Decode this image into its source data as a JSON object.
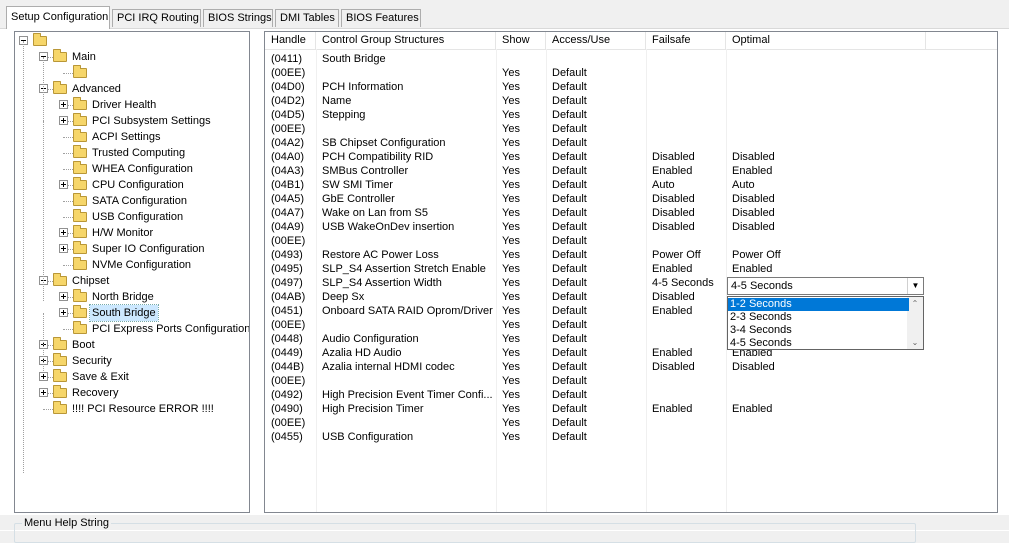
{
  "tabs": [
    {
      "label": "Setup Configuration",
      "active": true
    },
    {
      "label": "PCI IRQ Routing",
      "active": false
    },
    {
      "label": "BIOS Strings",
      "active": false
    },
    {
      "label": "DMI Tables",
      "active": false
    },
    {
      "label": "BIOS Features",
      "active": false
    }
  ],
  "tree": [
    {
      "label": "",
      "level": 0,
      "expander": "minus"
    },
    {
      "label": "Main",
      "level": 1,
      "expander": "minus"
    },
    {
      "label": "",
      "level": 2,
      "expander": "none"
    },
    {
      "label": "Advanced",
      "level": 1,
      "expander": "minus"
    },
    {
      "label": "Driver Health",
      "level": 2,
      "expander": "plus"
    },
    {
      "label": "PCI Subsystem Settings",
      "level": 2,
      "expander": "plus"
    },
    {
      "label": "ACPI Settings",
      "level": 2,
      "expander": "none"
    },
    {
      "label": "Trusted Computing",
      "level": 2,
      "expander": "none"
    },
    {
      "label": "WHEA Configuration",
      "level": 2,
      "expander": "none"
    },
    {
      "label": "CPU Configuration",
      "level": 2,
      "expander": "plus"
    },
    {
      "label": "SATA Configuration",
      "level": 2,
      "expander": "none"
    },
    {
      "label": "USB Configuration",
      "level": 2,
      "expander": "none"
    },
    {
      "label": "H/W Monitor",
      "level": 2,
      "expander": "plus"
    },
    {
      "label": "Super IO Configuration",
      "level": 2,
      "expander": "plus"
    },
    {
      "label": "NVMe Configuration",
      "level": 2,
      "expander": "none"
    },
    {
      "label": "Chipset",
      "level": 1,
      "expander": "minus"
    },
    {
      "label": "North Bridge",
      "level": 2,
      "expander": "plus"
    },
    {
      "label": "South Bridge",
      "level": 2,
      "expander": "plus",
      "selected": true
    },
    {
      "label": "PCI Express Ports Configuration",
      "level": 2,
      "expander": "none"
    },
    {
      "label": "Boot",
      "level": 1,
      "expander": "plus"
    },
    {
      "label": "Security",
      "level": 1,
      "expander": "plus"
    },
    {
      "label": "Save & Exit",
      "level": 1,
      "expander": "plus"
    },
    {
      "label": "Recovery",
      "level": 1,
      "expander": "plus"
    },
    {
      "label": "!!!! PCI Resource ERROR !!!!",
      "level": 1,
      "expander": "none"
    }
  ],
  "grid": {
    "columns": [
      "Handle",
      "Control Group Structures",
      "Show",
      "Access/Use",
      "Failsafe",
      "Optimal"
    ],
    "rows": [
      [
        "(0411)",
        "South Bridge",
        "",
        "",
        "",
        ""
      ],
      [
        "(00EE)",
        "",
        "Yes",
        "Default",
        "",
        ""
      ],
      [
        "(04D0)",
        "PCH Information",
        "Yes",
        "Default",
        "",
        ""
      ],
      [
        "(04D2)",
        "Name",
        "Yes",
        "Default",
        "",
        ""
      ],
      [
        "(04D5)",
        "Stepping",
        "Yes",
        "Default",
        "",
        ""
      ],
      [
        "(00EE)",
        "",
        "Yes",
        "Default",
        "",
        ""
      ],
      [
        "(04A2)",
        "SB Chipset Configuration",
        "Yes",
        "Default",
        "",
        ""
      ],
      [
        "(04A0)",
        "PCH Compatibility RID",
        "Yes",
        "Default",
        "Disabled",
        "Disabled"
      ],
      [
        "(04A3)",
        "SMBus Controller",
        "Yes",
        "Default",
        "Enabled",
        "Enabled"
      ],
      [
        "(04B1)",
        "SW SMI Timer",
        "Yes",
        "Default",
        "Auto",
        "Auto"
      ],
      [
        "(04A5)",
        "GbE Controller",
        "Yes",
        "Default",
        "Disabled",
        "Disabled"
      ],
      [
        "(04A7)",
        "Wake on Lan from S5",
        "Yes",
        "Default",
        "Disabled",
        "Disabled"
      ],
      [
        "(04A9)",
        "USB WakeOnDev insertion",
        "Yes",
        "Default",
        "Disabled",
        "Disabled"
      ],
      [
        "(00EE)",
        "",
        "Yes",
        "Default",
        "",
        ""
      ],
      [
        "(0493)",
        "Restore AC Power Loss",
        "Yes",
        "Default",
        "Power Off",
        "Power Off"
      ],
      [
        "(0495)",
        "SLP_S4 Assertion Stretch Enable",
        "Yes",
        "Default",
        "Enabled",
        "Enabled"
      ],
      [
        "(0497)",
        " SLP_S4 Assertion Width",
        "Yes",
        "Default",
        "4-5 Seconds",
        ""
      ],
      [
        "(04AB)",
        "Deep Sx",
        "Yes",
        "Default",
        "Disabled",
        ""
      ],
      [
        "(0451)",
        "Onboard SATA RAID Oprom/Driver",
        "Yes",
        "Default",
        "Enabled",
        ""
      ],
      [
        "(00EE)",
        "",
        "Yes",
        "Default",
        "",
        ""
      ],
      [
        "(0448)",
        "Audio Configuration",
        "Yes",
        "Default",
        "",
        ""
      ],
      [
        "(0449)",
        "Azalia HD Audio",
        "Yes",
        "Default",
        "Enabled",
        "Enabled"
      ],
      [
        "(044B)",
        "Azalia internal HDMI codec",
        "Yes",
        "Default",
        "Disabled",
        "Disabled"
      ],
      [
        "(00EE)",
        "",
        "Yes",
        "Default",
        "",
        ""
      ],
      [
        "(0492)",
        "High Precision Event Timer Confi...",
        "Yes",
        "Default",
        "",
        ""
      ],
      [
        "(0490)",
        "High Precision Timer",
        "Yes",
        "Default",
        "Enabled",
        "Enabled"
      ],
      [
        "(00EE)",
        "",
        "Yes",
        "Default",
        "",
        ""
      ],
      [
        "(0455)",
        "USB Configuration",
        "Yes",
        "Default",
        "",
        ""
      ]
    ]
  },
  "dropdown": {
    "value": "4-5 Seconds",
    "options": [
      "1-2 Seconds",
      "2-3 Seconds",
      "3-4 Seconds",
      "4-5 Seconds"
    ],
    "highlighted_index": 0
  },
  "help_group": {
    "title": "Menu Help String"
  }
}
